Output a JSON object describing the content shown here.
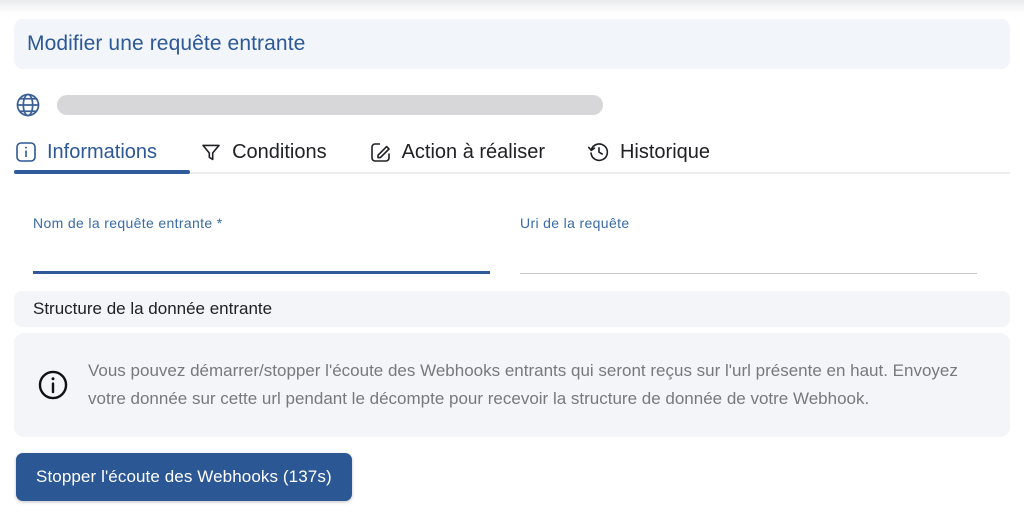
{
  "header": {
    "title": "Modifier une requête entrante",
    "title_color": "#2c5896",
    "banner_bg": "#f2f5fa"
  },
  "url_row": {
    "globe_icon": "globe-icon",
    "url_value": "",
    "url_placeholder_state": "masked"
  },
  "tabs": {
    "active_index": 0,
    "items": [
      {
        "label": "Informations",
        "icon": "info-square-icon"
      },
      {
        "label": "Conditions",
        "icon": "filter-funnel-icon"
      },
      {
        "label": "Action à réaliser",
        "icon": "edit-square-icon"
      },
      {
        "label": "Historique",
        "icon": "history-clock-icon"
      }
    ]
  },
  "form": {
    "fields": [
      {
        "label": "Nom de la requête entrante *",
        "value": "",
        "placeholder": "",
        "state": "focused"
      },
      {
        "label": "Uri de la requête",
        "value": "",
        "placeholder": "",
        "state": "default"
      }
    ]
  },
  "section": {
    "title": "Structure de la donnée entrante"
  },
  "alert": {
    "icon": "info-circle-icon",
    "text": "Vous pouvez démarrer/stopper l'écoute des Webhooks entrants qui seront reçus sur l'url présente en haut. Envoyez votre donnée sur cette url pendant le décompte pour recevoir la structure de donnée de votre Webhook."
  },
  "actions": {
    "stop_button_label": "Stopper l'écoute des Webhooks (137s)",
    "stop_button_color": "#2b5794",
    "countdown_seconds": "137"
  }
}
